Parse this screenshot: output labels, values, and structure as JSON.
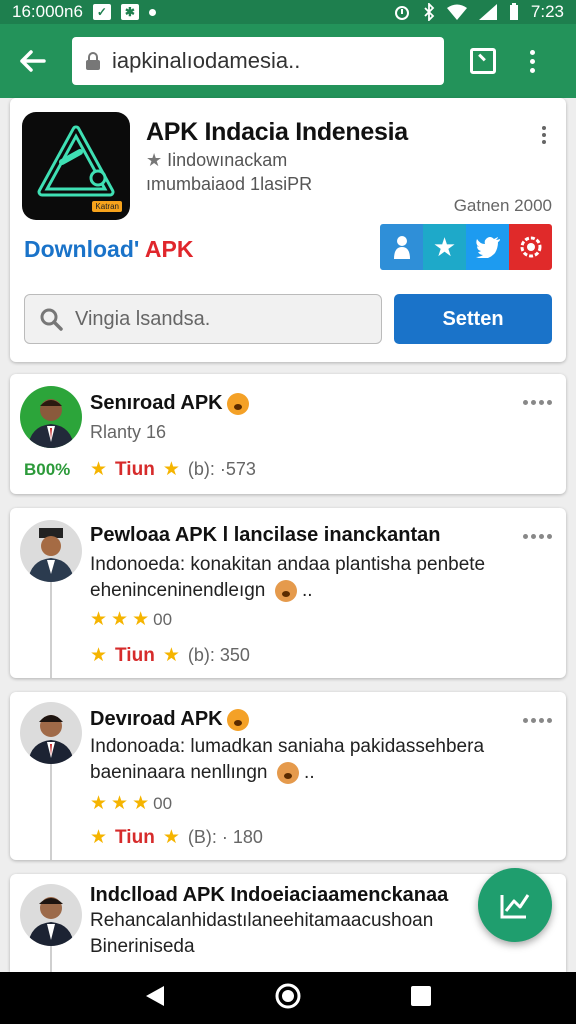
{
  "status_bar": {
    "left_text": "16:000n6",
    "time": "7:23"
  },
  "toolbar": {
    "url": "iapkinalıodamesia.."
  },
  "app": {
    "title": "APK Indacia Indenesia",
    "subtitle1": "Iindowınackam",
    "subtitle2": "ımumbaiaod 1lasiPR",
    "date": "Gatnen 2000",
    "download_a": "Download'",
    "download_b": "APK",
    "icon_badge": "Katran",
    "search_placeholder": "Vingia lsandsa.",
    "search_button": "Setten",
    "social_icons": [
      "person-icon",
      "star-icon",
      "twitter-icon",
      "share-gear-icon"
    ],
    "colors": {
      "download_blue": "#1a73c9",
      "download_red": "#e0262c",
      "toolbar_green": "#23935a"
    }
  },
  "posts": [
    {
      "title": "Senıroad APK",
      "meta": "Rlanty 16",
      "percent": "B00%",
      "action_label": "Tiun",
      "count": "(b): ·573"
    },
    {
      "title": "Pewloaa APK l lancilase inanckantan",
      "text": "Indonoeda: konakitan andaa plantisha penbete eheninceninendleıgn",
      "rating_value": "00",
      "action_label": "Tiun",
      "count": "(b):  350"
    },
    {
      "title": "Devıroad APK",
      "text": "Indonoada: lumadkan saniaha pakidassehbera baeninaara nenllıngn",
      "rating_value": "00",
      "action_label": "Tiun",
      "count": "(B): · 180"
    },
    {
      "title": "Indclload APK Indoeiaciaamenckanaa",
      "text": "Rehancalanhidastılaneehitamaacushoan Bineriniseda"
    }
  ]
}
